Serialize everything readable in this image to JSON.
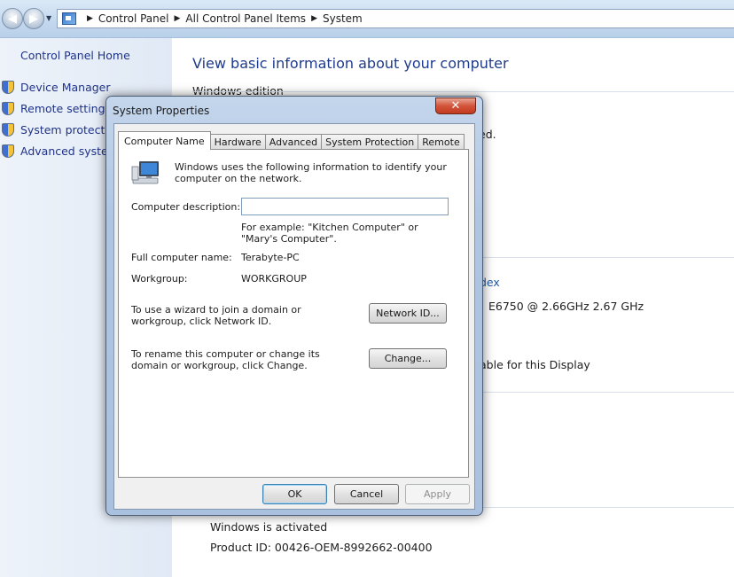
{
  "breadcrumb": [
    "Control Panel",
    "All Control Panel Items",
    "System"
  ],
  "left_nav": {
    "home": "Control Panel Home",
    "items": [
      "Device Manager",
      "Remote settings",
      "System protection",
      "Advanced system"
    ]
  },
  "main": {
    "title": "View basic information about your computer",
    "edition_heading": "Windows edition",
    "peek_ed": "ed.",
    "peek_index": "dex",
    "peek_cpu": "E6750  @ 2.66GHz   2.67 GHz",
    "peek_display": "able for this Display",
    "activated": "Windows is activated",
    "product_id": "Product ID: 00426-OEM-8992662-00400"
  },
  "dialog": {
    "title": "System Properties",
    "close_glyph": "✕",
    "tabs": [
      "Computer Name",
      "Hardware",
      "Advanced",
      "System Protection",
      "Remote"
    ],
    "intro": "Windows uses the following information to identify your computer on the network.",
    "description_label": "Computer description:",
    "description_value": "",
    "example": "For example: \"Kitchen Computer\" or \"Mary's Computer\".",
    "full_name_label": "Full computer name:",
    "full_name_value": "Terabyte-PC",
    "workgroup_label": "Workgroup:",
    "workgroup_value": "WORKGROUP",
    "network_text": "To use a wizard to join a domain or workgroup, click Network ID.",
    "network_button": "Network ID...",
    "rename_text": "To rename this computer or change its domain or workgroup, click Change.",
    "change_button": "Change...",
    "ok": "OK",
    "cancel": "Cancel",
    "apply": "Apply"
  },
  "icons": {
    "back": "back-arrow-icon",
    "forward": "forward-arrow-icon",
    "shield": "uac-shield-icon",
    "computer": "computer-network-icon"
  },
  "colors": {
    "link": "#1e3287",
    "title_blue": "#1e3a8a",
    "close_red": "#c23a1e"
  }
}
